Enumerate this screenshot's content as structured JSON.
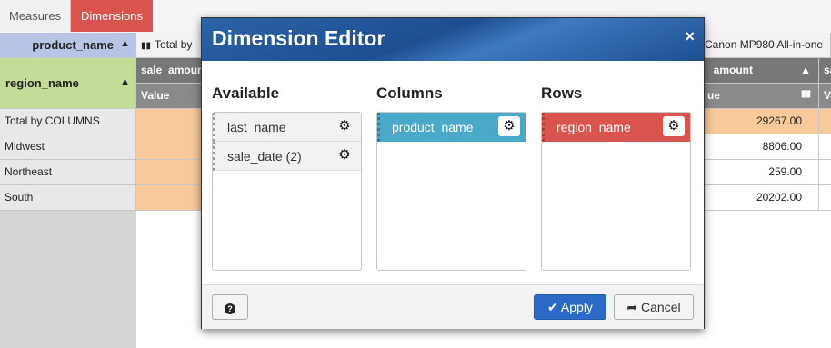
{
  "tabs": {
    "measures": "Measures",
    "dimensions": "Dimensions"
  },
  "grid": {
    "column_dimension": "product_name",
    "row_dimension": "region_name",
    "column_total_label": "Total by",
    "visible_column_product": "Canon MP980 All-in-one",
    "measure_label_left": "sale_amount",
    "measure_label_right": "_amount",
    "measure_label_far": "sa",
    "value_label_left": "Value",
    "value_label_right": "ue",
    "value_label_far": "Va",
    "rows": [
      {
        "label": "Total by COLUMNS",
        "value": "29267.00"
      },
      {
        "label": "Midwest",
        "value": "8806.00"
      },
      {
        "label": "Northeast",
        "value": "259.00"
      },
      {
        "label": "South",
        "value": "20202.00"
      }
    ],
    "accent_total_color": "#f7c99b",
    "col_dim_color": "#b7c4e6",
    "row_dim_color": "#c3dd98"
  },
  "modal": {
    "title": "Dimension Editor",
    "close_symbol": "×",
    "available_title": "Available",
    "columns_title": "Columns",
    "rows_title": "Rows",
    "available_items": [
      "last_name",
      "sale_date (2)"
    ],
    "columns_items": [
      "product_name"
    ],
    "rows_items": [
      "region_name"
    ],
    "help_symbol": "?",
    "apply_label": "Apply",
    "cancel_label": "Cancel",
    "apply_icon": "check-icon",
    "cancel_icon": "share-icon"
  }
}
